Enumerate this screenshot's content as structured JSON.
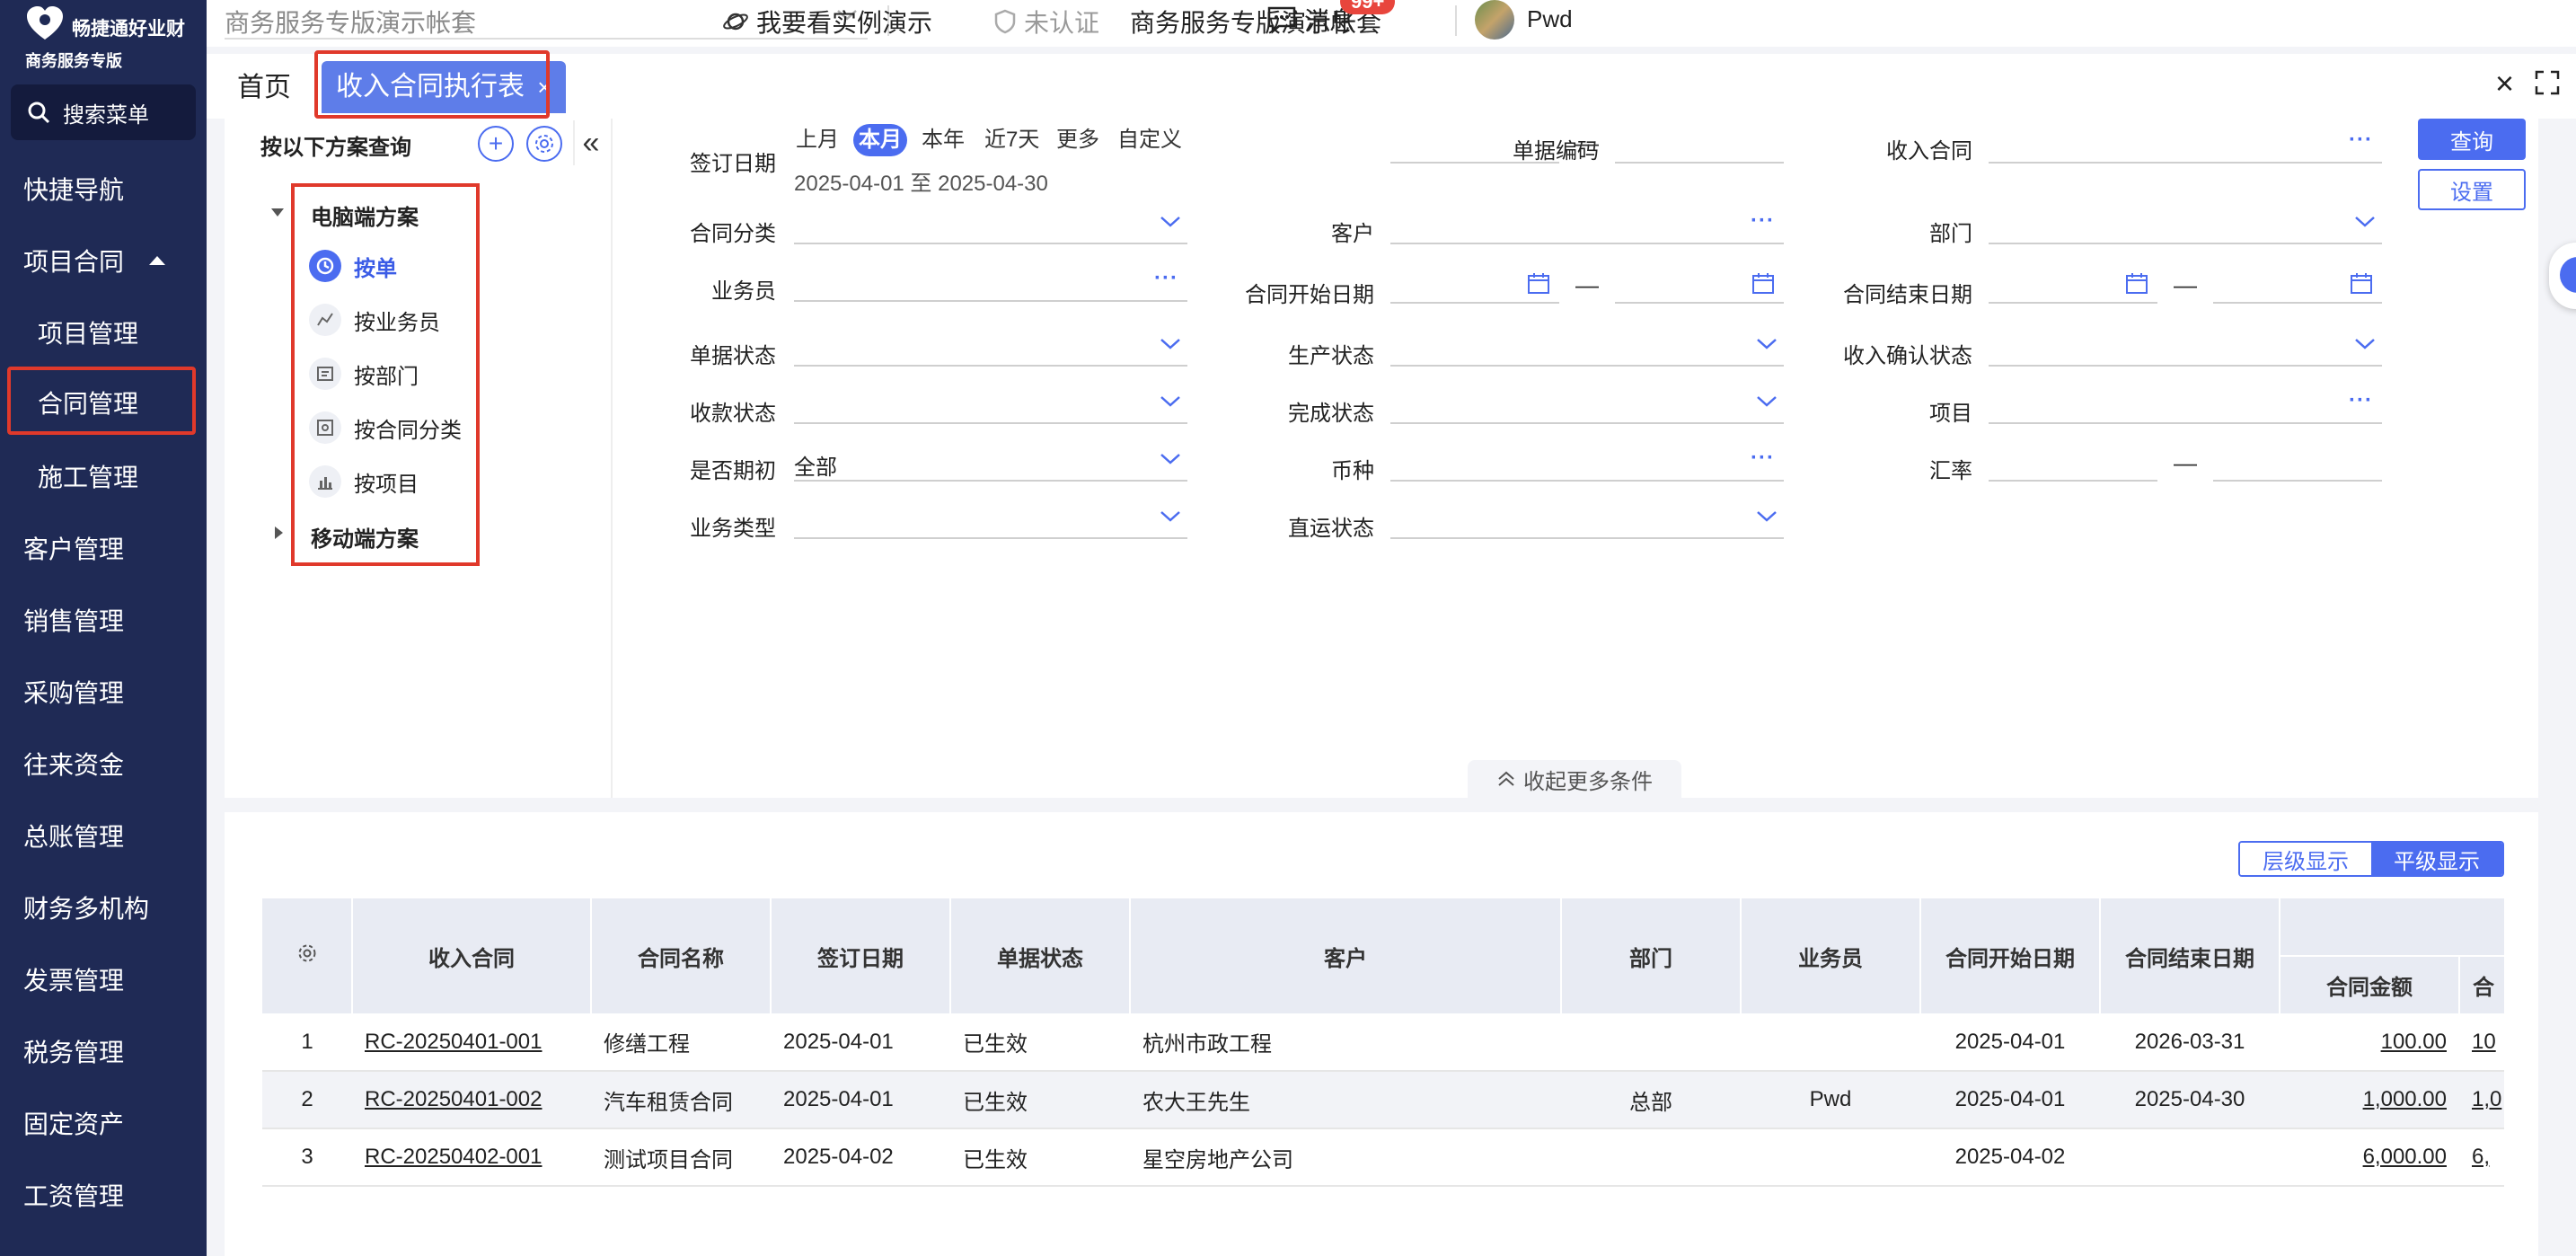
{
  "app": {
    "name": "畅捷通好业财",
    "edition": "商务服务专版"
  },
  "sidebar": {
    "search_label": "搜索菜单",
    "items": [
      {
        "label": "快捷导航"
      },
      {
        "label": "项目合同"
      },
      {
        "label": "项目管理"
      },
      {
        "label": "合同管理"
      },
      {
        "label": "施工管理"
      },
      {
        "label": "客户管理"
      },
      {
        "label": "销售管理"
      },
      {
        "label": "采购管理"
      },
      {
        "label": "往来资金"
      },
      {
        "label": "总账管理"
      },
      {
        "label": "财务多机构"
      },
      {
        "label": "发票管理"
      },
      {
        "label": "税务管理"
      },
      {
        "label": "固定资产"
      },
      {
        "label": "工资管理"
      }
    ]
  },
  "topbar": {
    "account_select": "商务服务专版演示帐套",
    "demo_link": "我要看实例演示",
    "cert_status": "未认证",
    "account_name": "商务服务专版演示帐套",
    "messages": "消息",
    "message_badge": "99+",
    "username": "Pwd"
  },
  "tabs": {
    "home": "首页",
    "active": "收入合同执行表",
    "active_close": "×",
    "close_all": "×"
  },
  "scheme": {
    "title": "按以下方案查询",
    "collapse": "«",
    "pc_group": "电脑端方案",
    "items": [
      "按单",
      "按业务员",
      "按部门",
      "按合同分类",
      "按项目"
    ],
    "mobile_group": "移动端方案"
  },
  "filters": {
    "sign_date": "签订日期",
    "date_chips": [
      "上月",
      "本月",
      "本年",
      "近7天",
      "更多",
      "自定义"
    ],
    "date_range": "2025-04-01 至 2025-04-30",
    "doc_no": "单据编码",
    "income_contract": "收入合同",
    "contract_category": "合同分类",
    "customer": "客户",
    "department": "部门",
    "salesperson": "业务员",
    "contract_start": "合同开始日期",
    "contract_end": "合同结束日期",
    "doc_status": "单据状态",
    "production_status": "生产状态",
    "income_confirm_status": "收入确认状态",
    "payment_status": "收款状态",
    "completion_status": "完成状态",
    "project": "项目",
    "is_opening": "是否期初",
    "is_opening_value": "全部",
    "currency": "币种",
    "exchange_rate": "汇率",
    "business_type": "业务类型",
    "direct_status": "直运状态",
    "dash": "—",
    "query_button": "查询",
    "settings_button": "设置",
    "collapse_more": "收起更多条件"
  },
  "results": {
    "view_level": "层级显示",
    "view_flat": "平级显示",
    "columns": [
      "收入合同",
      "合同名称",
      "签订日期",
      "单据状态",
      "客户",
      "部门",
      "业务员",
      "合同开始日期",
      "合同结束日期",
      "合同金额",
      "合"
    ],
    "rows": [
      {
        "no": "1",
        "contract": "RC-20250401-001",
        "name": "修缮工程",
        "sign_date": "2025-04-01",
        "status": "已生效",
        "customer": "杭州市政工程",
        "dept": "",
        "sales": "",
        "start": "2025-04-01",
        "end": "2026-03-31",
        "amount": "100.00",
        "extra": "10"
      },
      {
        "no": "2",
        "contract": "RC-20250401-002",
        "name": "汽车租赁合同",
        "sign_date": "2025-04-01",
        "status": "已生效",
        "customer": "农大王先生",
        "dept": "总部",
        "sales": "Pwd",
        "start": "2025-04-01",
        "end": "2025-04-30",
        "amount": "1,000.00",
        "extra": "1,0"
      },
      {
        "no": "3",
        "contract": "RC-20250402-001",
        "name": "测试项目合同",
        "sign_date": "2025-04-02",
        "status": "已生效",
        "customer": "星空房地产公司",
        "dept": "",
        "sales": "",
        "start": "2025-04-02",
        "end": "",
        "amount": "6,000.00",
        "extra": "6,"
      }
    ]
  },
  "colors": {
    "sidebar_bg": "#1f2a55",
    "accent": "#4b6cf0",
    "highlight_box": "#e0392b"
  }
}
